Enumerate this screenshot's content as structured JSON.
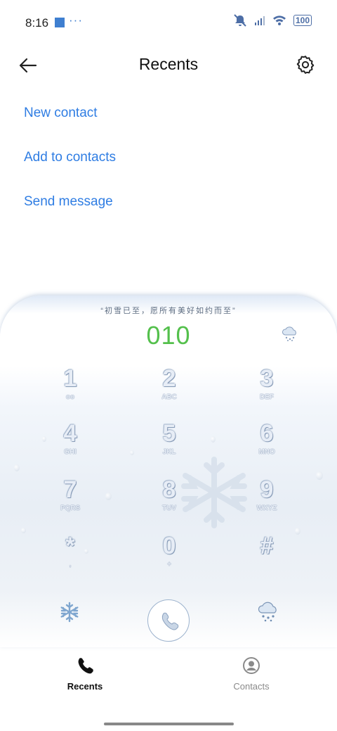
{
  "status_bar": {
    "time": "8:16",
    "more": "···",
    "battery": "100"
  },
  "header": {
    "title": "Recents",
    "back_icon": "arrow-left-icon",
    "settings_icon": "gear-icon"
  },
  "actions": {
    "new_contact": "New contact",
    "add_to_contacts": "Add to contacts",
    "send_message": "Send message"
  },
  "dialer": {
    "quote": "“初雪已至，愿所有美好如约而至”",
    "number": "010",
    "keys": [
      {
        "digit": "1",
        "letters": "oo"
      },
      {
        "digit": "2",
        "letters": "ABC"
      },
      {
        "digit": "3",
        "letters": "DEF"
      },
      {
        "digit": "4",
        "letters": "GHI"
      },
      {
        "digit": "5",
        "letters": "JKL"
      },
      {
        "digit": "6",
        "letters": "MNO"
      },
      {
        "digit": "7",
        "letters": "PQRS"
      },
      {
        "digit": "8",
        "letters": "TUV"
      },
      {
        "digit": "9",
        "letters": "WXYZ"
      },
      {
        "digit": "*",
        "letters": ","
      },
      {
        "digit": "0",
        "letters": "+"
      },
      {
        "digit": "#",
        "letters": ""
      }
    ]
  },
  "bottom_nav": {
    "recents": "Recents",
    "contacts": "Contacts"
  },
  "colors": {
    "accent": "#2f7de3",
    "number": "#54c04c"
  }
}
